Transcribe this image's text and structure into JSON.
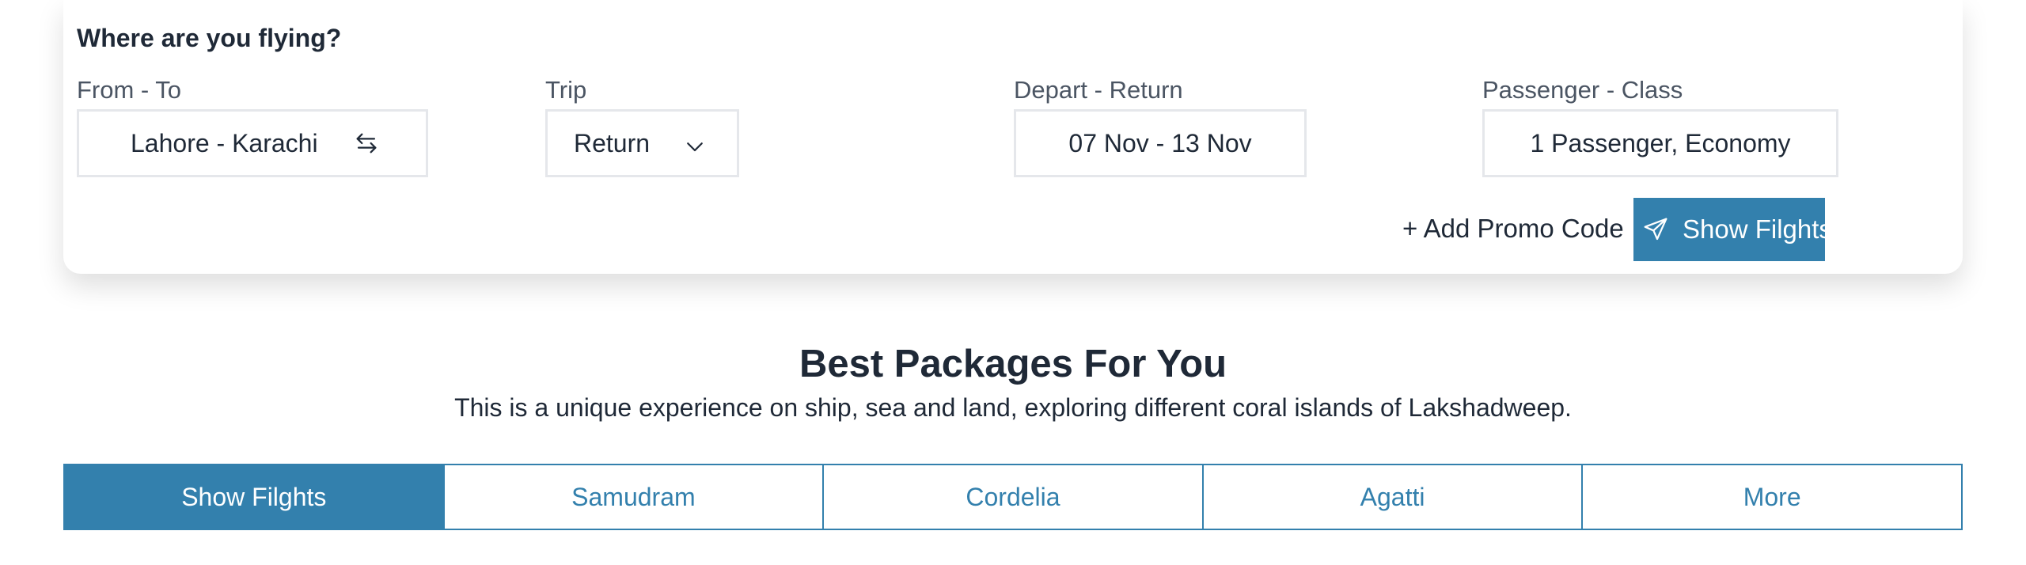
{
  "search": {
    "heading": "Where are you flying?",
    "from_to": {
      "label": "From - To",
      "value": "Lahore - Karachi",
      "icon": "swap-arrows-icon"
    },
    "trip": {
      "label": "Trip",
      "value": "Return",
      "icon": "chevron-down-icon"
    },
    "dates": {
      "label": "Depart - Return",
      "value": "07 Nov - 13 Nov"
    },
    "passengers": {
      "label": "Passenger - Class",
      "value": "1 Passenger, Economy"
    },
    "promo_label": "+ Add Promo Code",
    "submit": {
      "label": "Show Filghts",
      "icon": "paper-plane-icon"
    }
  },
  "packages": {
    "title": "Best Packages For You",
    "subtitle": "This is a unique experience on ship, sea and land, exploring different coral islands of Lakshadweep.",
    "tabs": [
      {
        "label": "Show Filghts",
        "active": true
      },
      {
        "label": "Samudram",
        "active": false
      },
      {
        "label": "Cordelia",
        "active": false
      },
      {
        "label": "Agatti",
        "active": false
      },
      {
        "label": "More",
        "active": false
      }
    ]
  },
  "colors": {
    "accent": "#3380ad",
    "text": "#1f2937",
    "border": "#e5e7eb"
  }
}
